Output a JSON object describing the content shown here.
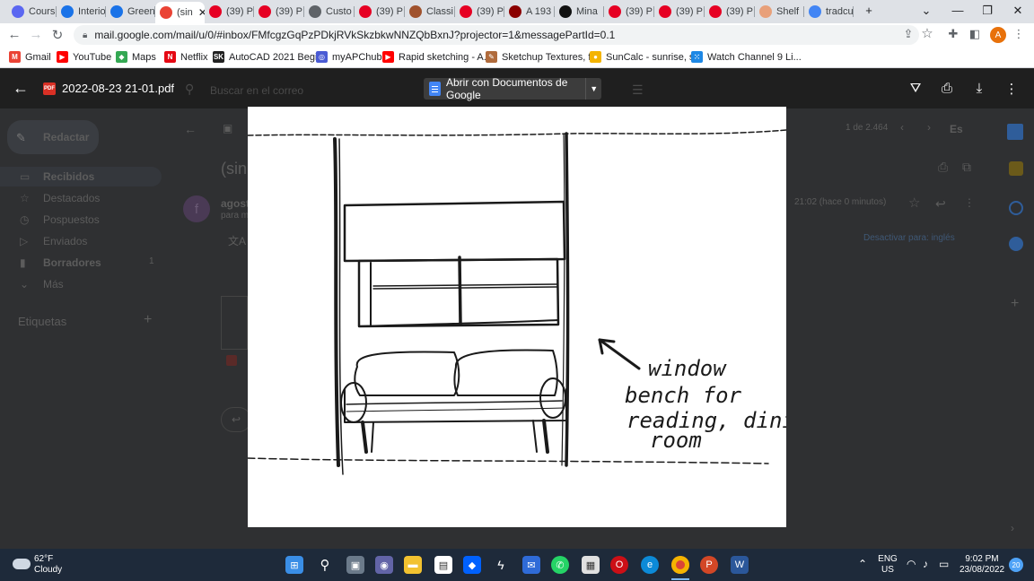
{
  "browser": {
    "tabs": [
      {
        "label": "Cours",
        "icon": "course-icon",
        "color": "#5b67f1"
      },
      {
        "label": "Interio",
        "icon": "browser-icon",
        "color": "#1a73e8"
      },
      {
        "label": "Green",
        "icon": "browser-icon",
        "color": "#1a73e8"
      },
      {
        "label": "(sin",
        "icon": "gmail-icon",
        "color": "#ea4335",
        "active": true
      },
      {
        "label": "(39) P",
        "icon": "pinterest-icon",
        "color": "#e60023"
      },
      {
        "label": "(39) P",
        "icon": "pinterest-icon",
        "color": "#e60023"
      },
      {
        "label": "Custo",
        "icon": "image-icon",
        "color": "#5f6368"
      },
      {
        "label": "(39) P",
        "icon": "pinterest-icon",
        "color": "#e60023"
      },
      {
        "label": "Classi",
        "icon": "bookmark-icon",
        "color": "#a0522d"
      },
      {
        "label": "(39) P",
        "icon": "pinterest-icon",
        "color": "#e60023"
      },
      {
        "label": "A 193",
        "icon": "n-icon",
        "color": "#8b0000"
      },
      {
        "label": "Mina",
        "icon": "circle-icon",
        "color": "#111111"
      },
      {
        "label": "(39) P",
        "icon": "pinterest-icon",
        "color": "#e60023"
      },
      {
        "label": "(39) P",
        "icon": "pinterest-icon",
        "color": "#e60023"
      },
      {
        "label": "(39) P",
        "icon": "pinterest-icon",
        "color": "#e60023"
      },
      {
        "label": "Shelf",
        "icon": "shelf-icon",
        "color": "#e8a07a"
      },
      {
        "label": "tradcu",
        "icon": "google-icon",
        "color": "#4285f4"
      }
    ],
    "url": "mail.google.com/mail/u/0/#inbox/FMfcgzGqPzPDkjRVkSkzbkwNNZQbBxnJ?projector=1&messagePartId=0.1",
    "avatar_letter": "A",
    "bookmarks": [
      {
        "label": "Gmail",
        "color": "#ea4335",
        "glyph": "M"
      },
      {
        "label": "YouTube",
        "color": "#ff0000",
        "glyph": "▶"
      },
      {
        "label": "Maps",
        "color": "#34a853",
        "glyph": "◆"
      },
      {
        "label": "Netflix",
        "color": "#e50914",
        "glyph": "N"
      },
      {
        "label": "AutoCAD 2021 Begi...",
        "color": "#222222",
        "glyph": "SK"
      },
      {
        "label": "myAPChub",
        "color": "#4a5bd4",
        "glyph": "◎"
      },
      {
        "label": "Rapid sketching - A...",
        "color": "#ff0000",
        "glyph": "▶"
      },
      {
        "label": "Sketchup Textures, f...",
        "color": "#b06b3c",
        "glyph": "✎"
      },
      {
        "label": "SunCalc - sunrise, s...",
        "color": "#f4b400",
        "glyph": "●"
      },
      {
        "label": "Watch Channel 9 Li...",
        "color": "#1e88e5",
        "glyph": "⁙"
      }
    ]
  },
  "viewer": {
    "filename": "2022-08-23 21-01.pdf",
    "pdf_badge": "PDF",
    "open_with_label": "Abrir con Documentos de Google",
    "sketch_caption": [
      "window",
      "bench for",
      "reading, dining",
      "room"
    ]
  },
  "gmail_behind": {
    "search_placeholder": "Buscar en el correo",
    "compose": "Redactar",
    "nav": [
      {
        "label": "Recibidos",
        "count": ""
      },
      {
        "label": "Destacados",
        "count": ""
      },
      {
        "label": "Pospuestos",
        "count": ""
      },
      {
        "label": "Enviados",
        "count": ""
      },
      {
        "label": "Borradores",
        "count": "1"
      },
      {
        "label": "Más",
        "count": ""
      }
    ],
    "labels_heading": "Etiquetas",
    "pager": "1 de 2.464",
    "lang": "Es",
    "subject": "(sin",
    "sender": "agost",
    "sender_avatar": "f",
    "to": "para m",
    "time": "21:02 (hace 0 minutos)",
    "translate": "Desactivar para: inglés"
  },
  "taskbar": {
    "temp": "62°F",
    "condition": "Cloudy",
    "lang_top": "ENG",
    "lang_bottom": "US",
    "time": "9:02 PM",
    "date": "23/08/2022",
    "notifications": "20"
  }
}
